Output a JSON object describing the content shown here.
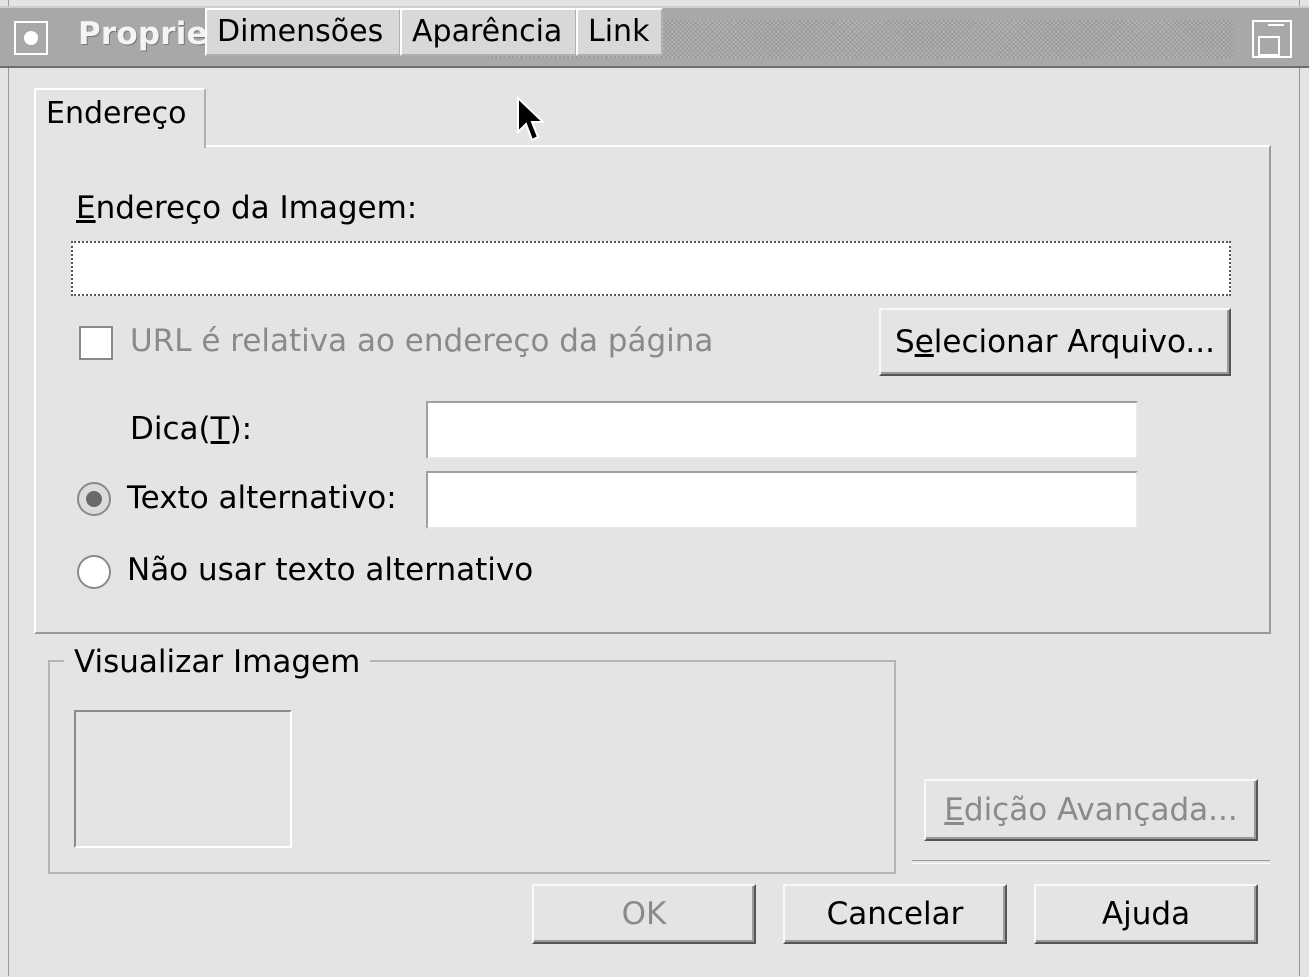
{
  "window": {
    "title": "Propriedades da Imagem"
  },
  "tabs": [
    {
      "label": "Endereço",
      "active": true
    },
    {
      "label": "Dimensões",
      "active": false
    },
    {
      "label": "Aparência",
      "active": false
    },
    {
      "label": "Link",
      "active": false
    }
  ],
  "address": {
    "label_mnemonic": "E",
    "label_rest": "ndereço da Imagem:",
    "value": "",
    "relative_checkbox_label": "URL é relativa ao endereço da página",
    "relative_checked": false,
    "select_file_pre": "S",
    "select_file_mnemonic": "e",
    "select_file_rest": "lecionar Arquivo..."
  },
  "tooltip": {
    "label_pre": "Dica(",
    "label_mnemonic": "T",
    "label_post": "):",
    "value": ""
  },
  "alt_text": {
    "label": "Texto alternativo:",
    "value": "",
    "selected": true
  },
  "no_alt": {
    "label": "Não usar texto alternativo",
    "selected": false
  },
  "preview": {
    "title": "Visualizar Imagem"
  },
  "advanced_edit": {
    "mnemonic": "E",
    "rest": "dição Avançada..."
  },
  "buttons": {
    "ok": "OK",
    "cancel": "Cancelar",
    "help": "Ajuda"
  }
}
